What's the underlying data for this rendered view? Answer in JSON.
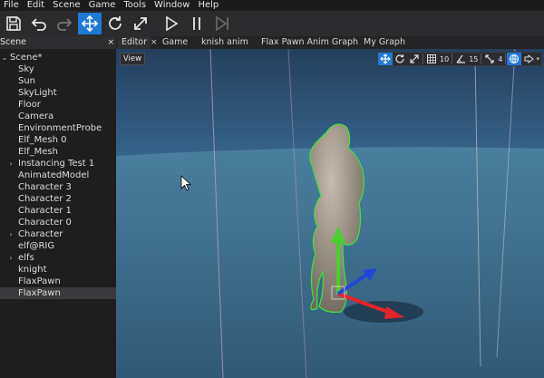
{
  "menu": [
    "File",
    "Edit",
    "Scene",
    "Game",
    "Tools",
    "Window",
    "Help"
  ],
  "toolbar": {
    "buttons": [
      "save-icon",
      "undo-icon",
      "redo-icon",
      "translate-gizmo-icon",
      "rotate-gizmo-icon",
      "scale-gizmo-icon",
      "play-icon",
      "pause-icon",
      "step-icon"
    ],
    "active": "translate-gizmo-icon",
    "accent": "#1f7ad6"
  },
  "scene_panel": {
    "tab_label": "Scene",
    "close": "×",
    "tree": [
      {
        "label": "Scene*",
        "expander": "⌄",
        "depth": 0
      },
      {
        "label": "Sky",
        "depth": 1
      },
      {
        "label": "Sun",
        "depth": 1
      },
      {
        "label": "SkyLight",
        "depth": 1
      },
      {
        "label": "Floor",
        "depth": 1
      },
      {
        "label": "Camera",
        "depth": 1
      },
      {
        "label": "EnvironmentProbe",
        "depth": 1
      },
      {
        "label": "Elf_Mesh 0",
        "depth": 1
      },
      {
        "label": "Elf_Mesh",
        "depth": 1
      },
      {
        "label": "Instancing Test 1",
        "expander": "›",
        "depth": 1
      },
      {
        "label": "AnimatedModel",
        "depth": 1
      },
      {
        "label": "Character 3",
        "depth": 1
      },
      {
        "label": "Character 2",
        "depth": 1
      },
      {
        "label": "Character 1",
        "depth": 1
      },
      {
        "label": "Character 0",
        "depth": 1
      },
      {
        "label": "Character",
        "expander": "›",
        "depth": 1
      },
      {
        "label": "elf@RIG",
        "depth": 1
      },
      {
        "label": "elfs",
        "expander": "›",
        "depth": 1
      },
      {
        "label": "knight",
        "depth": 1
      },
      {
        "label": "FlaxPawn",
        "depth": 1
      },
      {
        "label": "FlaxPawn",
        "depth": 1,
        "selected": true
      }
    ]
  },
  "tabs": {
    "editor": "Editor",
    "editor_close": "×",
    "game": "Game",
    "knish": "knish anim",
    "flax_pawn_graph": "Flax Pawn Anim Graph",
    "my_graph": "My Graph"
  },
  "viewport": {
    "view_label": "View",
    "grid_size": "10",
    "rotation_snap": "15",
    "scale_snap": "4",
    "colors": {
      "sky": "#2a527a",
      "floor": "#3f6f8f",
      "axis_x": "#e8232a",
      "axis_y": "#47d12c",
      "axis_z": "#2147d8",
      "selection_outline": "#3fe03a"
    }
  }
}
